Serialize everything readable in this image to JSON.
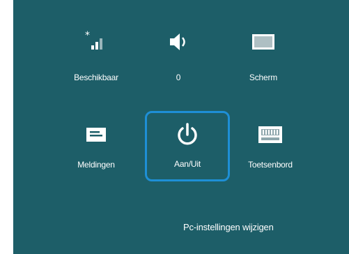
{
  "panel": {
    "background": "#1d5e68",
    "focus_color": "#1e8fd6"
  },
  "tiles": [
    {
      "label": "Beschikbaar",
      "icon": "network-signal-icon"
    },
    {
      "label": "0",
      "icon": "volume-icon"
    },
    {
      "label": "Scherm",
      "icon": "screen-icon"
    },
    {
      "label": "Meldingen",
      "icon": "notifications-icon"
    },
    {
      "label": "Aan/Uit",
      "icon": "power-icon"
    },
    {
      "label": "Toetsenbord",
      "icon": "keyboard-icon"
    }
  ],
  "footer": {
    "link": "Pc-instellingen wijzigen"
  }
}
